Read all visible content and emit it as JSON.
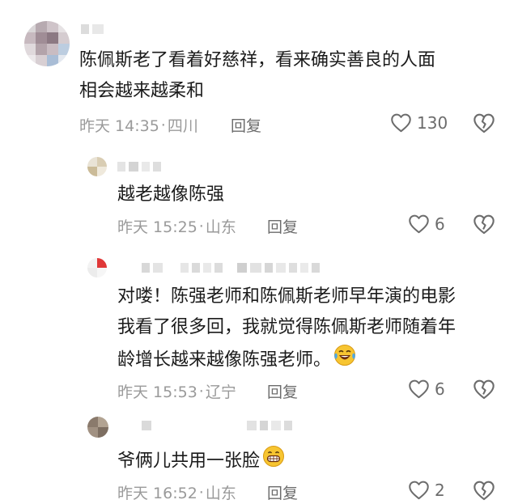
{
  "comments": [
    {
      "text": "陈佩斯老了看着好慈祥，看来确实善良的人面相会越来越柔和",
      "text_lines": [
        "陈佩斯老了看着好慈祥，看来确实善良的人面",
        "相会越来越柔和"
      ],
      "time": "昨天 14:35",
      "location": "四川",
      "reply_label": "回复",
      "likes": "130"
    },
    {
      "text": "越老越像陈强",
      "time": "昨天 15:25",
      "location": "山东",
      "reply_label": "回复",
      "likes": "6"
    },
    {
      "text_lines": [
        "对喽！陈强老师和陈佩斯老师早年演的电影",
        "我看了很多回，我就觉得陈佩斯老师随着年",
        "龄增长越来越像陈强老师。"
      ],
      "time": "昨天 15:53",
      "location": "辽宁",
      "reply_label": "回复",
      "likes": "6",
      "emoji": "laughing-tears-emoji"
    },
    {
      "text": "爷俩儿共用一张脸",
      "time": "昨天 16:52",
      "location": "山东",
      "reply_label": "回复",
      "likes": "2",
      "emoji": "grinning-emoji"
    }
  ],
  "separator": "·",
  "colors": {
    "text": "#1b1b1b",
    "meta": "#9a9a9a",
    "icon": "#6c6c6c"
  },
  "icons": [
    "heart-outline-icon",
    "broken-heart-icon"
  ]
}
